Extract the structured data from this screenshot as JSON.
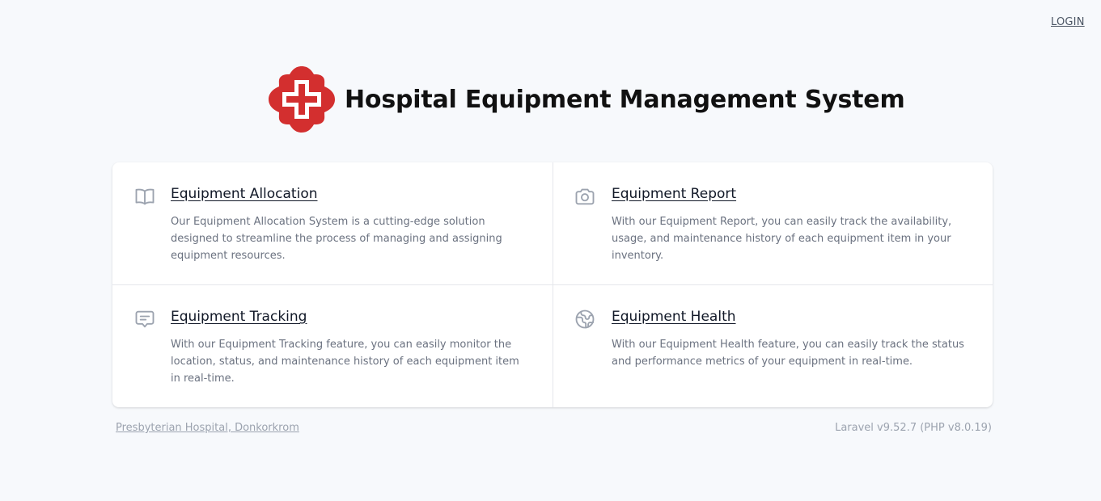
{
  "nav": {
    "login_label": "LOGIN"
  },
  "header": {
    "title": "Hospital Equipment Management System",
    "logo_icon": "red-cross-icon",
    "logo_color": "#d32f2f"
  },
  "features": [
    {
      "icon": "book-open-icon",
      "title": "Equipment Allocation",
      "description": "Our Equipment Allocation System is a cutting-edge solution designed to streamline the process of managing and assigning equipment resources."
    },
    {
      "icon": "camera-icon",
      "title": "Equipment Report",
      "description": "With our Equipment Report, you can easily track the availability, usage, and maintenance history of each equipment item in your inventory."
    },
    {
      "icon": "chat-alt-icon",
      "title": "Equipment Tracking",
      "description": "With our Equipment Tracking feature, you can easily monitor the location, status, and maintenance history of each equipment item in real-time."
    },
    {
      "icon": "globe-icon",
      "title": "Equipment Health",
      "description": "With our Equipment Health feature, you can easily track the status and performance metrics of your equipment in real-time."
    }
  ],
  "footer": {
    "link_label": "Presbyterian Hospital, Donkorkrom",
    "version": "Laravel v9.52.7 (PHP v8.0.19)"
  },
  "colors": {
    "background": "#f7f9fc",
    "icon_gray": "#9ca3af",
    "text_muted": "#6b7280"
  }
}
